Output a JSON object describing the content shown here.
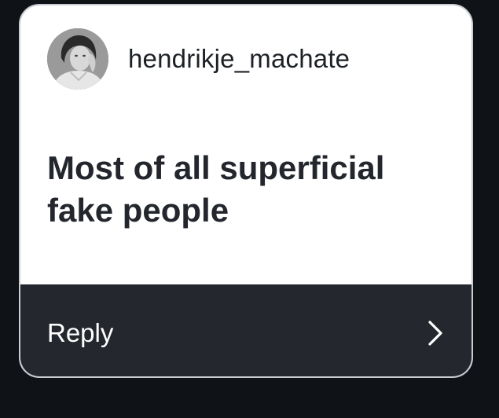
{
  "card": {
    "username": "hendrikje_machate",
    "question": "Most of all superficial fake people",
    "reply_label": "Reply"
  },
  "icons": {
    "avatar": "profile-photo",
    "reply_arrow": "chevron-right-icon"
  },
  "colors": {
    "card_bg": "#ffffff",
    "reply_bar_bg": "#24282e",
    "page_bg": "#0f1216",
    "text_dark": "#23272d"
  }
}
